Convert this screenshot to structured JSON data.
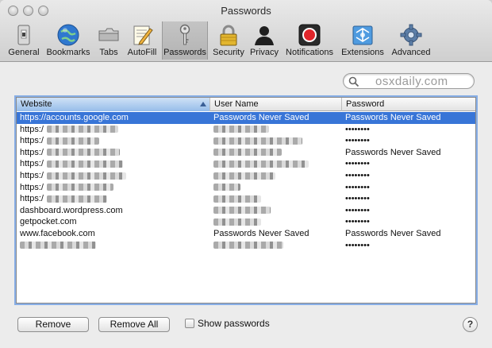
{
  "window": {
    "title": "Passwords"
  },
  "toolbar": {
    "items": [
      {
        "label": "General",
        "icon": "general-switch-icon"
      },
      {
        "label": "Bookmarks",
        "icon": "globe-icon"
      },
      {
        "label": "Tabs",
        "icon": "tabs-icon"
      },
      {
        "label": "AutoFill",
        "icon": "autofill-pencil-icon"
      },
      {
        "label": "Passwords",
        "icon": "key-icon",
        "selected": true
      },
      {
        "label": "Security",
        "icon": "padlock-icon"
      },
      {
        "label": "Privacy",
        "icon": "person-silhouette-icon"
      },
      {
        "label": "Notifications",
        "icon": "notification-record-icon"
      },
      {
        "label": "Extensions",
        "icon": "puzzle-icon"
      },
      {
        "label": "Advanced",
        "icon": "gear-icon"
      }
    ]
  },
  "search": {
    "value": "osxdaily.com"
  },
  "table": {
    "headers": {
      "website": "Website",
      "username": "User Name",
      "password": "Password"
    },
    "rows": [
      {
        "website": "https://accounts.google.com",
        "username": "Passwords Never Saved",
        "password": "Passwords Never Saved",
        "selected": true
      },
      {
        "website": "https:/",
        "website_redacted": true,
        "username": "",
        "username_redacted": true,
        "password": "••••••••"
      },
      {
        "website": "https:/",
        "website_redacted": true,
        "username": "",
        "username_redacted": true,
        "password": "••••••••"
      },
      {
        "website": "https:/",
        "website_redacted": true,
        "username": "",
        "username_redacted": true,
        "password": "Passwords Never Saved"
      },
      {
        "website": "https:/",
        "website_redacted": true,
        "username": "",
        "username_redacted": true,
        "password": "••••••••"
      },
      {
        "website": "https:/",
        "website_redacted": true,
        "username": "",
        "username_redacted": true,
        "password": "••••••••"
      },
      {
        "website": "https:/",
        "website_redacted": true,
        "username": "",
        "username_redacted": true,
        "password": "••••••••"
      },
      {
        "website": "https:/",
        "website_redacted": true,
        "username": "",
        "username_redacted": true,
        "password": "••••••••"
      },
      {
        "website": "dashboard.wordpress.com",
        "username": "",
        "username_redacted": true,
        "password": "••••••••"
      },
      {
        "website": "getpocket.com",
        "username": "",
        "username_redacted": true,
        "password": "••••••••"
      },
      {
        "website": "www.facebook.com",
        "username": "Passwords Never Saved",
        "password": "Passwords Never Saved"
      },
      {
        "website": "",
        "website_redacted": true,
        "username": "",
        "username_redacted": true,
        "password": "••••••••"
      }
    ]
  },
  "buttons": {
    "remove": "Remove",
    "remove_all": "Remove All"
  },
  "show_passwords": {
    "label": "Show passwords",
    "checked": false
  },
  "help": {
    "label": "?"
  },
  "colors": {
    "selection": "#3875d7",
    "focus_ring": "#87aee6",
    "sorted_header": "#96bde9"
  }
}
